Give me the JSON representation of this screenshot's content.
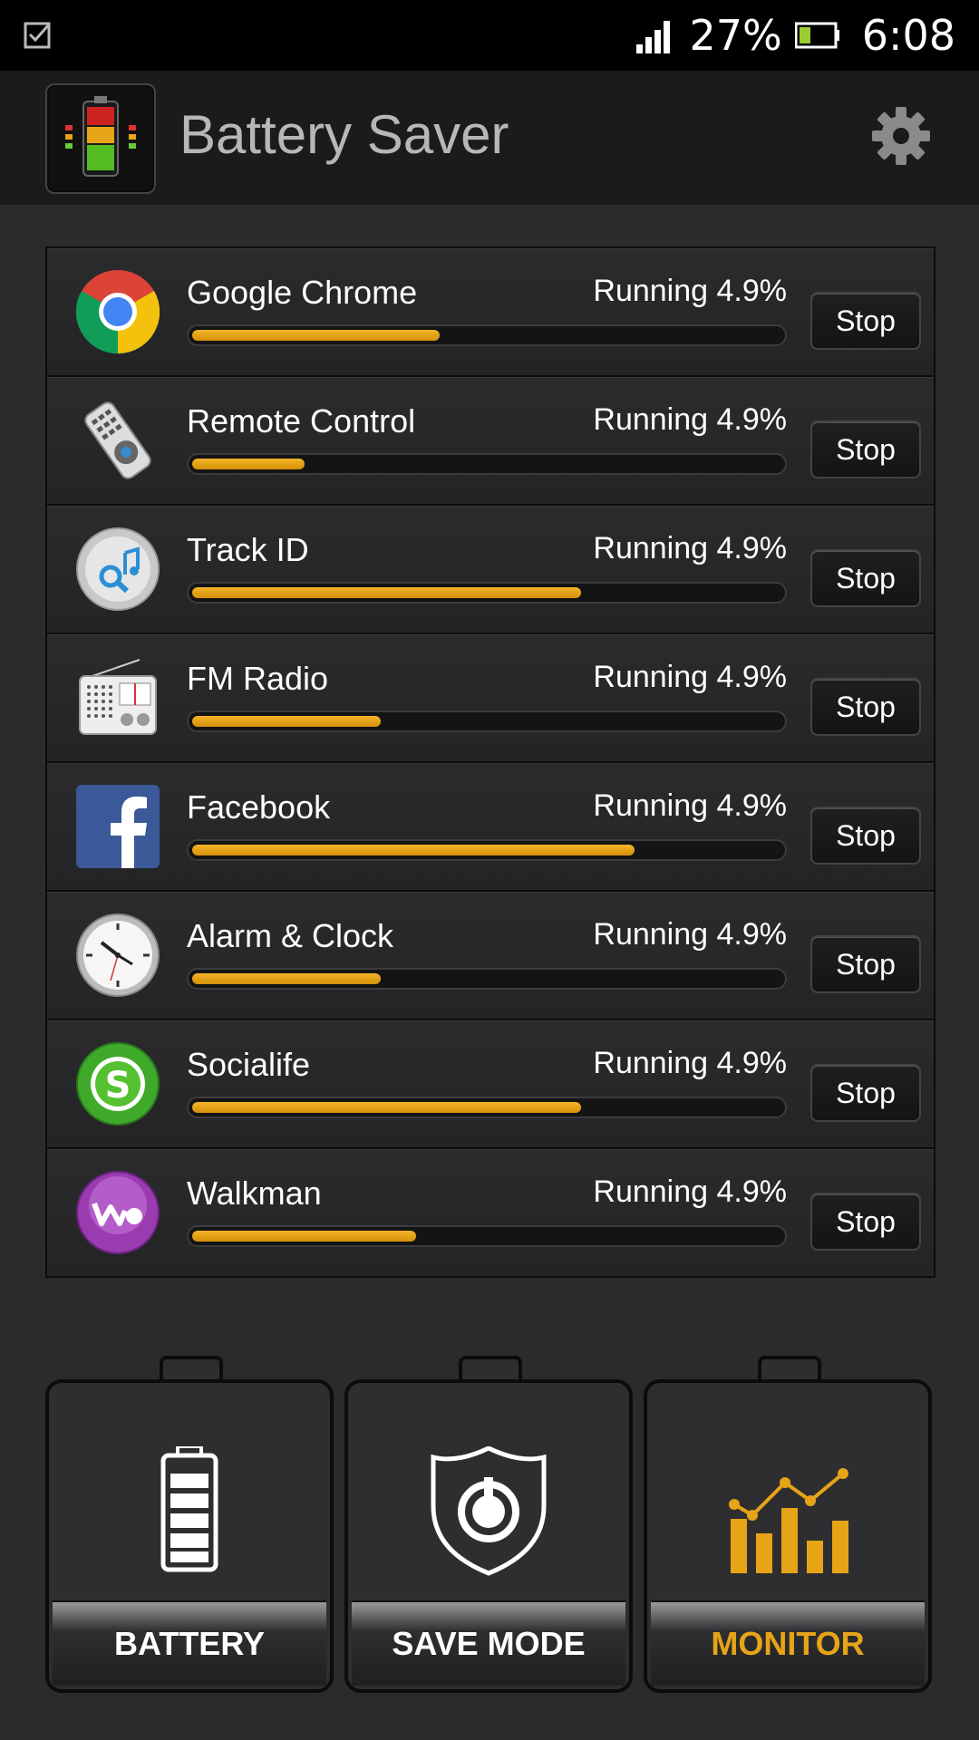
{
  "status_bar": {
    "battery_pct": "27%",
    "time": "6:08"
  },
  "app_bar": {
    "title": "Battery Saver"
  },
  "apps": [
    {
      "name": "Google Chrome",
      "status": "Running 4.9%",
      "stop_label": "Stop",
      "usage": 0.42,
      "icon": "chrome-icon"
    },
    {
      "name": "Remote Control",
      "status": "Running 4.9%",
      "stop_label": "Stop",
      "usage": 0.19,
      "icon": "remote-control-icon"
    },
    {
      "name": "Track ID",
      "status": "Running 4.9%",
      "stop_label": "Stop",
      "usage": 0.66,
      "icon": "track-id-icon"
    },
    {
      "name": "FM Radio",
      "status": "Running 4.9%",
      "stop_label": "Stop",
      "usage": 0.32,
      "icon": "fm-radio-icon"
    },
    {
      "name": "Facebook",
      "status": "Running 4.9%",
      "stop_label": "Stop",
      "usage": 0.75,
      "icon": "facebook-icon"
    },
    {
      "name": "Alarm & Clock",
      "status": "Running 4.9%",
      "stop_label": "Stop",
      "usage": 0.32,
      "icon": "clock-icon"
    },
    {
      "name": "Socialife",
      "status": "Running 4.9%",
      "stop_label": "Stop",
      "usage": 0.66,
      "icon": "socialife-icon"
    },
    {
      "name": "Walkman",
      "status": "Running 4.9%",
      "stop_label": "Stop",
      "usage": 0.38,
      "icon": "walkman-icon"
    }
  ],
  "bottom_nav": [
    {
      "label": "BATTERY",
      "icon": "battery-icon",
      "active": false
    },
    {
      "label": "SAVE MODE",
      "icon": "shield-power-icon",
      "active": false
    },
    {
      "label": "MONITOR",
      "icon": "chart-icon",
      "active": true
    }
  ],
  "colors": {
    "accent": "#e8a417",
    "progress": "#f0ac1e",
    "inactive_text": "#ffffff"
  }
}
